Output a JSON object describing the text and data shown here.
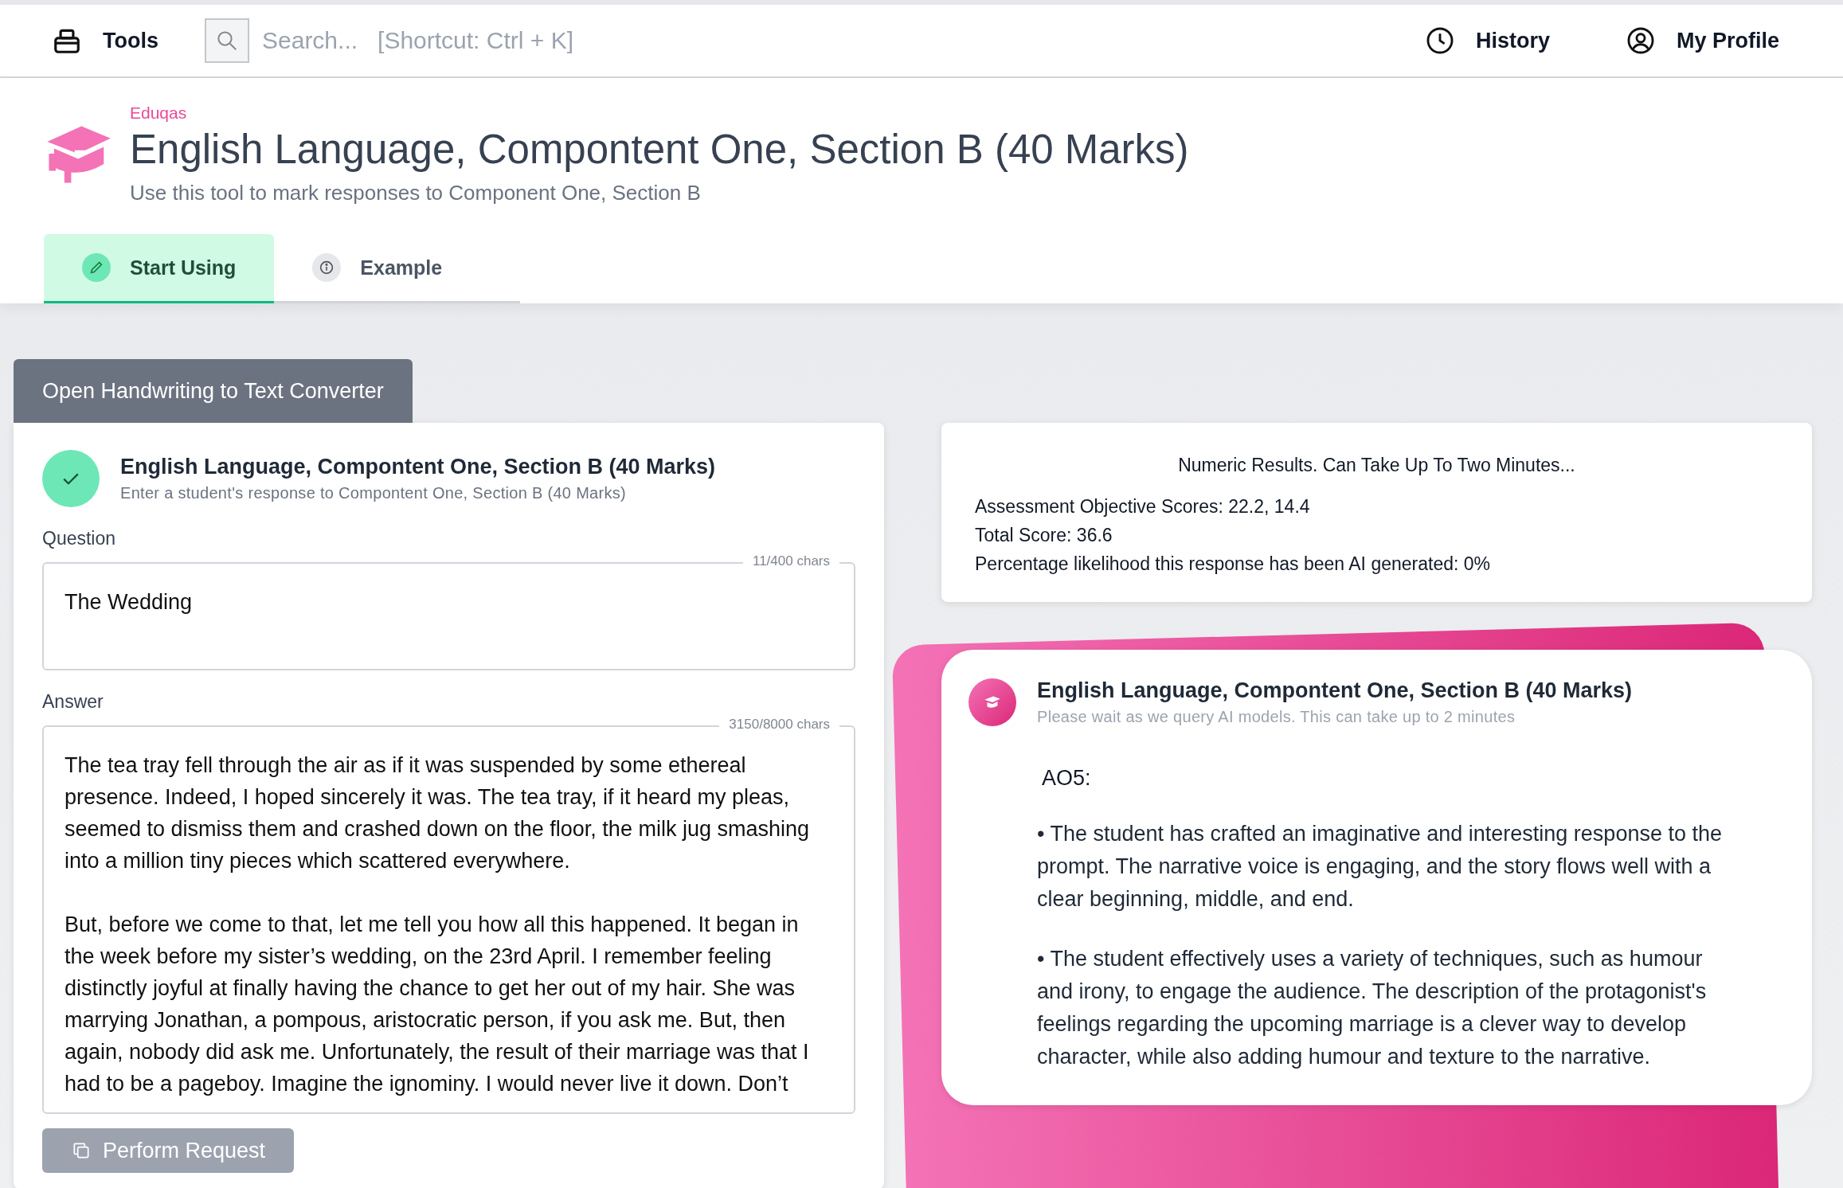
{
  "topbar": {
    "tools_label": "Tools",
    "search": {
      "placeholder": "Search...   [Shortcut: Ctrl + K]"
    },
    "links": [
      {
        "label": "History",
        "kind": "history"
      },
      {
        "label": "My Profile",
        "kind": "profile"
      }
    ]
  },
  "header": {
    "provider": "Eduqas",
    "title": "English Language, Compontent One, Section B (40 Marks)",
    "subtitle": "Use this tool to mark responses to Component One, Section B"
  },
  "tabs": [
    {
      "label": "Start Using",
      "selected": true,
      "kind": "edit"
    },
    {
      "label": "Example",
      "selected": false,
      "kind": "info"
    }
  ],
  "converter_button": "Open Handwriting to Text Converter",
  "form": {
    "title": "English Language, Compontent One, Section B (40 Marks)",
    "subtitle": "Enter a student's response to Compontent One, Section B (40 Marks)",
    "complete": true,
    "fields": [
      {
        "label": "Question",
        "counter": "11/400 chars",
        "value": "The Wedding",
        "kind": "short"
      },
      {
        "label": "Answer",
        "counter": "3150/8000 chars",
        "value": "The tea tray fell through the air as if it was suspended by some ethereal presence. Indeed, I hoped sincerely it was. The tea tray, if it heard my pleas, seemed to dismiss them and crashed down on the floor, the milk jug smashing into a million tiny pieces which scattered everywhere.\n\nBut, before we come to that, let me tell you how all this happened. It began in the week before my sister’s wedding, on the 23rd April. I remember feeling distinctly joyful at finally having the chance to get her out of my hair. She was marrying Jonathan, a pompous, aristocratic person, if you ask me. But, then again, nobody did ask me. Unfortunately, the result of their marriage was that I had to be a pageboy. Imagine the ignominy. I would never live it down. Don’t",
        "kind": "long"
      }
    ],
    "submit": {
      "label": "Perform Request",
      "disabled": true
    }
  },
  "results": {
    "heading": "Numeric Results. Can Take Up To Two Minutes...",
    "lines": [
      "Assessment Objective Scores: 22.2, 14.4",
      "Total Score: 36.6",
      "Percentage likelihood this response has been AI generated: 0%"
    ]
  },
  "feedback": {
    "title": "English Language, Compontent One, Section B (40 Marks)",
    "subtitle": "Please wait as we query AI models. This can take up to 2 minutes",
    "heading": "AO5:",
    "paragraphs": [
      "• The student has crafted an imaginative and interesting response to the prompt. The narrative voice is engaging, and the story flows well with a clear beginning, middle, and end.",
      "• The student effectively uses a variety of techniques, such as humour and irony, to engage the audience. The description of the protagonist's feelings regarding the upcoming marriage is a clever way to develop character, while also adding humour and texture to the narrative."
    ]
  }
}
